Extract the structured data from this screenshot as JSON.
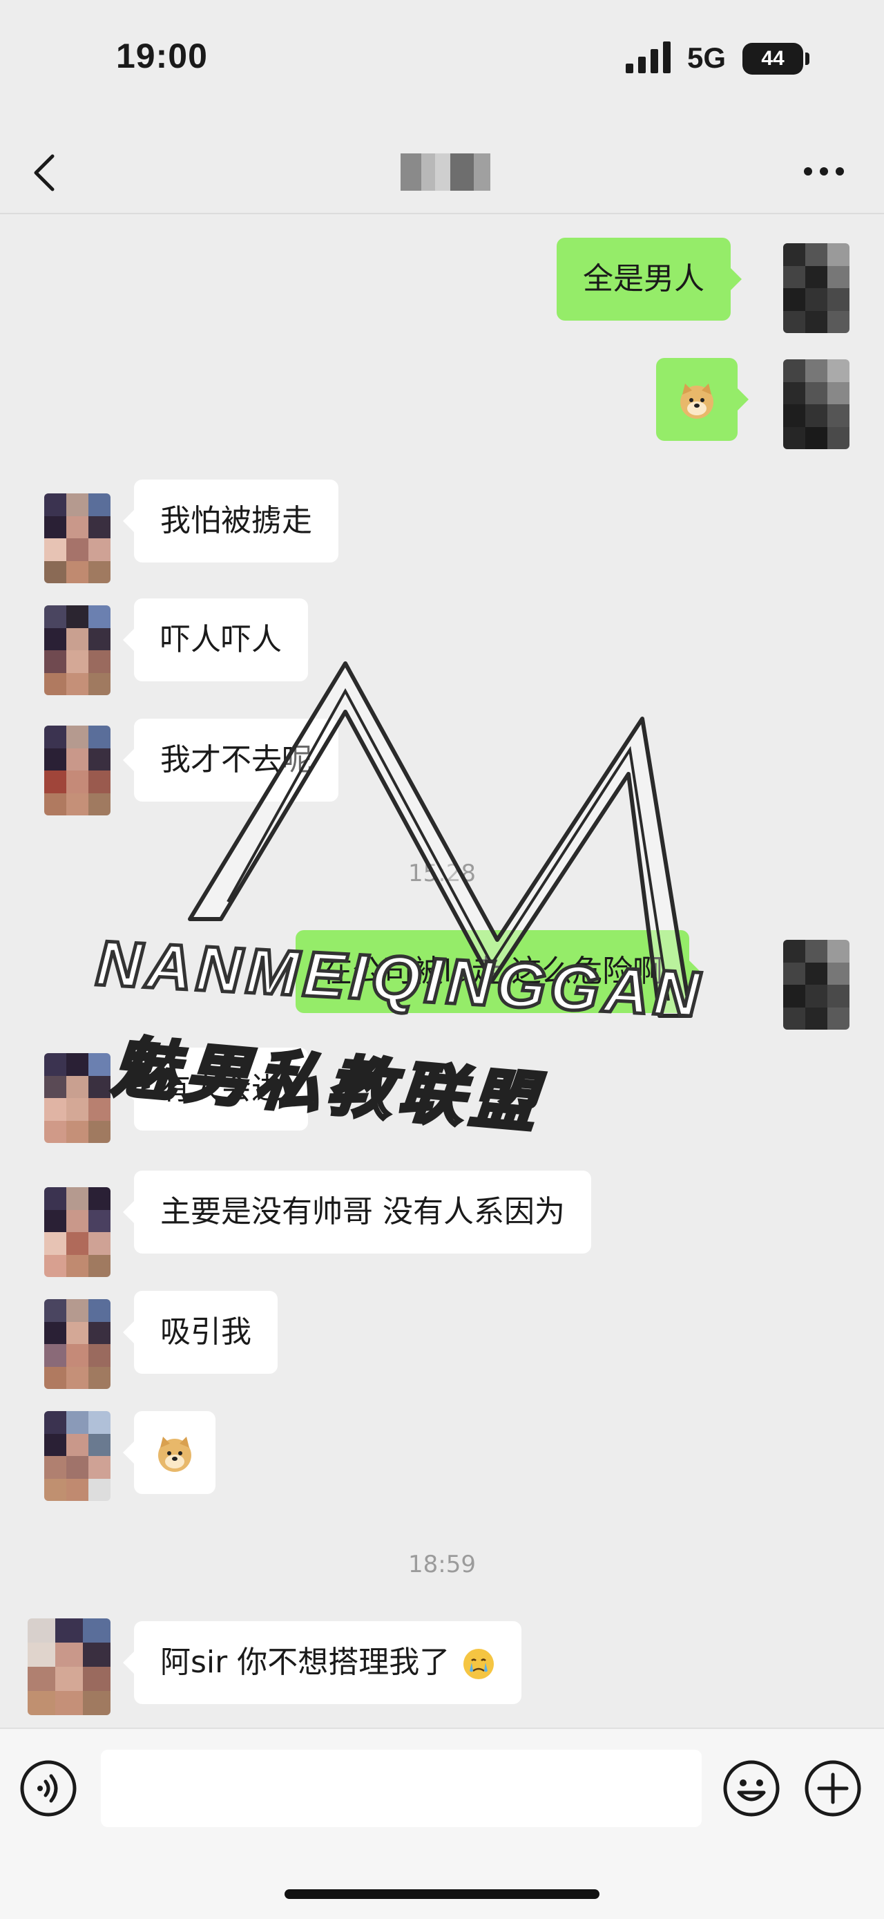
{
  "status": {
    "time": "19:00",
    "network": "5G",
    "battery": "44"
  },
  "nav": {
    "contact_name": ""
  },
  "messages": [
    {
      "side": "out",
      "text": "全是男人"
    },
    {
      "side": "out",
      "emoji": "doge"
    },
    {
      "side": "in",
      "text": "我怕被掳走"
    },
    {
      "side": "in",
      "text": "吓人吓人"
    },
    {
      "side": "in",
      "text": "我才不去呢"
    },
    {
      "type": "time",
      "text": "15:28"
    },
    {
      "side": "out",
      "text": "在公司被lu走 这么危险啊"
    },
    {
      "side": "in",
      "text": "有人会进"
    },
    {
      "side": "in",
      "text": "主要是没有帅哥 没有人系因为"
    },
    {
      "side": "in",
      "text": "吸引我"
    },
    {
      "side": "in",
      "emoji": "doge"
    },
    {
      "type": "time",
      "text": "18:59"
    },
    {
      "side": "in",
      "text": "阿sir  你不想搭理我了",
      "trailing_emoji": "crying-face"
    }
  ],
  "m": {
    "t0": "全是男人",
    "t2": "我怕被掳走",
    "t3": "吓人吓人",
    "t4": "我才不去呢",
    "time1": "15:28",
    "t6": "在公司被lu走 这么危险啊",
    "t7": "有人会进",
    "t8": "主要是没有帅哥 没有人系因为",
    "t9": "吸引我",
    "time2": "18:59",
    "t12": "阿sir  你不想搭理我了"
  },
  "watermark": {
    "line1": "NANMEIQINGGAN",
    "line2": "魅男私教联盟"
  },
  "input": {
    "placeholder": ""
  },
  "colors": {
    "outgoing_bubble": "#95ec69",
    "incoming_bubble": "#ffffff",
    "background": "#ededed"
  }
}
